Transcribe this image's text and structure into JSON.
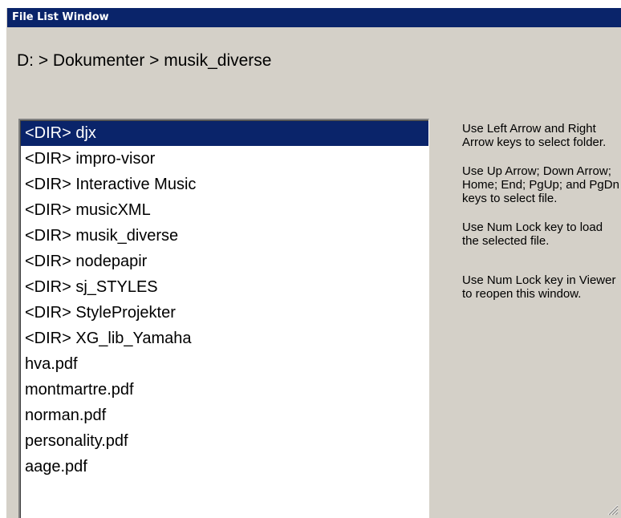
{
  "window": {
    "title": "File List Window"
  },
  "path": {
    "text": "D: > Dokumenter > musik_diverse"
  },
  "file_list": {
    "items": [
      {
        "label": "<DIR> djx",
        "selected": true
      },
      {
        "label": "<DIR> impro-visor",
        "selected": false
      },
      {
        "label": "<DIR> Interactive Music",
        "selected": false
      },
      {
        "label": "<DIR> musicXML",
        "selected": false
      },
      {
        "label": "<DIR> musik_diverse",
        "selected": false
      },
      {
        "label": "<DIR> nodepapir",
        "selected": false
      },
      {
        "label": "<DIR> sj_STYLES",
        "selected": false
      },
      {
        "label": "<DIR> StyleProjekter",
        "selected": false
      },
      {
        "label": "<DIR> XG_lib_Yamaha",
        "selected": false
      },
      {
        "label": "hva.pdf",
        "selected": false
      },
      {
        "label": "montmartre.pdf",
        "selected": false
      },
      {
        "label": "norman.pdf",
        "selected": false
      },
      {
        "label": "personality.pdf",
        "selected": false
      },
      {
        "label": "aage.pdf",
        "selected": false
      }
    ]
  },
  "help": {
    "lines": [
      "Use Left Arrow and Right Arrow keys to select folder.",
      "Use Up Arrow; Down Arrow; Home; End; PgUp; and PgDn keys to select file.",
      "Use Num Lock key to load the selected file.",
      "Use Num Lock key in Viewer to reopen this window."
    ]
  },
  "colors": {
    "window_bg": "#d4d0c8",
    "titlebar_bg": "#0a246a",
    "selection_bg": "#0a246a"
  },
  "icons": {
    "resize_grip": "resize-grip-icon"
  }
}
